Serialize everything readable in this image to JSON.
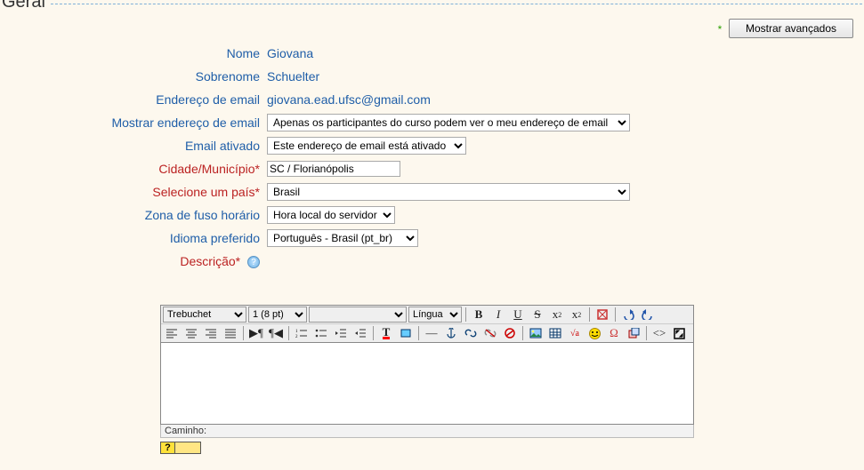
{
  "legend": "Geral",
  "btn_advanced": "Mostrar avançados",
  "labels": {
    "nome": "Nome",
    "sobrenome": "Sobrenome",
    "email": "Endereço de email",
    "mostrar_email": "Mostrar endereço de email",
    "email_ativado": "Email ativado",
    "cidade": "Cidade/Município",
    "pais": "Selecione um país",
    "fuso": "Zona de fuso horário",
    "idioma": "Idioma preferido",
    "descricao": "Descrição"
  },
  "values": {
    "nome": "Giovana",
    "sobrenome": "Schuelter",
    "email": "giovana.ead.ufsc@gmail.com",
    "mostrar_email": "Apenas os participantes do curso podem ver o meu endereço de email",
    "email_ativado": "Este endereço de email está ativado",
    "cidade": "SC / Florianópolis",
    "pais": "Brasil",
    "fuso": "Hora local do servidor",
    "idioma": "Português - Brasil (pt_br)"
  },
  "editor": {
    "font": "Trebuchet",
    "size": "1 (8 pt)",
    "lang_label": "Língua",
    "path_label": "Caminho:"
  },
  "req_mark": "*"
}
